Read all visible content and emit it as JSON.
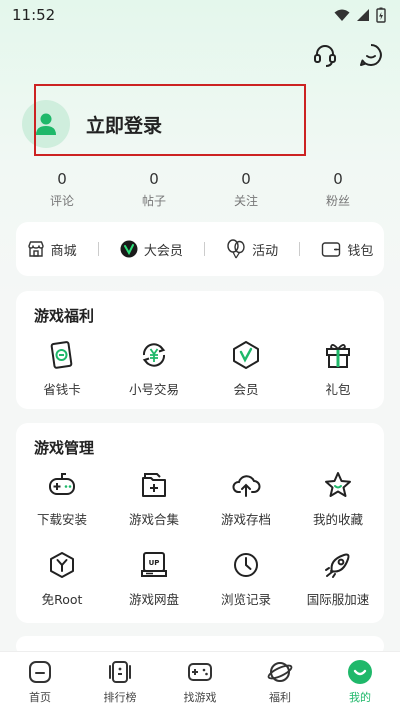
{
  "status": {
    "time": "11:52"
  },
  "profile": {
    "login_label": "立即登录"
  },
  "stats": [
    {
      "value": "0",
      "label": "评论"
    },
    {
      "value": "0",
      "label": "帖子"
    },
    {
      "value": "0",
      "label": "关注"
    },
    {
      "value": "0",
      "label": "粉丝"
    }
  ],
  "quick_links": [
    {
      "label": "商城",
      "icon": "store-icon"
    },
    {
      "label": "大会员",
      "icon": "vip-icon"
    },
    {
      "label": "活动",
      "icon": "balloon-icon"
    },
    {
      "label": "钱包",
      "icon": "wallet-icon"
    }
  ],
  "benefits": {
    "title": "游戏福利",
    "items": [
      {
        "label": "省钱卡",
        "icon": "savings-card-icon"
      },
      {
        "label": "小号交易",
        "icon": "trade-icon"
      },
      {
        "label": "会员",
        "icon": "member-icon"
      },
      {
        "label": "礼包",
        "icon": "gift-icon"
      }
    ]
  },
  "management": {
    "title": "游戏管理",
    "items": [
      {
        "label": "下载安装",
        "icon": "gamepad-icon"
      },
      {
        "label": "游戏合集",
        "icon": "collection-folder-icon"
      },
      {
        "label": "游戏存档",
        "icon": "cloud-upload-icon"
      },
      {
        "label": "我的收藏",
        "icon": "star-icon"
      },
      {
        "label": "免Root",
        "icon": "no-root-icon"
      },
      {
        "label": "游戏网盘",
        "icon": "cloud-disk-icon"
      },
      {
        "label": "浏览记录",
        "icon": "clock-icon"
      },
      {
        "label": "国际服加速",
        "icon": "rocket-icon"
      }
    ]
  },
  "tabs": [
    {
      "label": "首页",
      "icon": "home-icon"
    },
    {
      "label": "排行榜",
      "icon": "ranking-icon"
    },
    {
      "label": "找游戏",
      "icon": "find-game-icon"
    },
    {
      "label": "福利",
      "icon": "planet-icon"
    },
    {
      "label": "我的",
      "icon": "me-icon",
      "active": true
    }
  ],
  "colors": {
    "accent": "#1fb86a",
    "highlight": "#cc2222"
  }
}
